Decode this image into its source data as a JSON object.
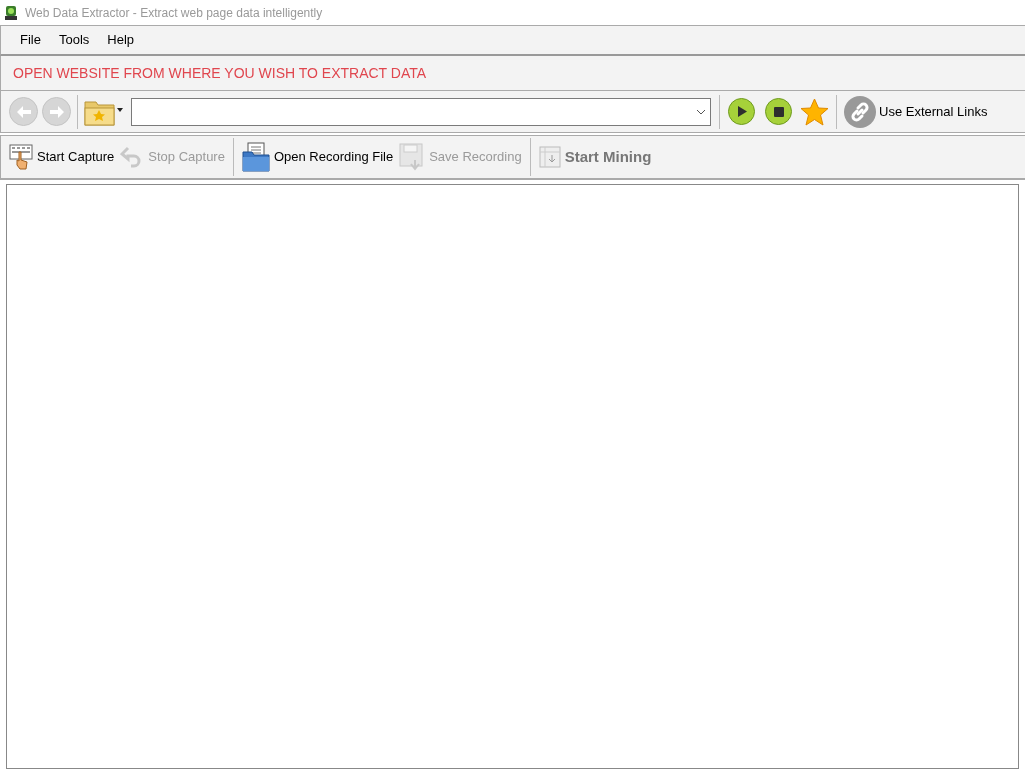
{
  "window": {
    "title": "Web Data Extractor -  Extract web page data intelligently"
  },
  "menu": [
    "File",
    "Tools",
    "Help"
  ],
  "banner": "OPEN WEBSITE FROM WHERE YOU WISH TO EXTRACT DATA",
  "nav": {
    "back_disabled": true,
    "forward_disabled": true,
    "external_links": "Use External Links"
  },
  "capture_toolbar": [
    {
      "kind": "start-capture",
      "label": "Start Capture",
      "disabled": false,
      "emphasis": false
    },
    {
      "kind": "stop-capture",
      "label": "Stop Capture",
      "disabled": true,
      "emphasis": false
    },
    {
      "kind": "open-recording",
      "label": "Open Recording File",
      "disabled": false,
      "emphasis": false
    },
    {
      "kind": "save-recording",
      "label": "Save Recording",
      "disabled": true,
      "emphasis": false
    },
    {
      "kind": "start-mining",
      "label": "Start Mining",
      "disabled": true,
      "emphasis": true
    }
  ]
}
